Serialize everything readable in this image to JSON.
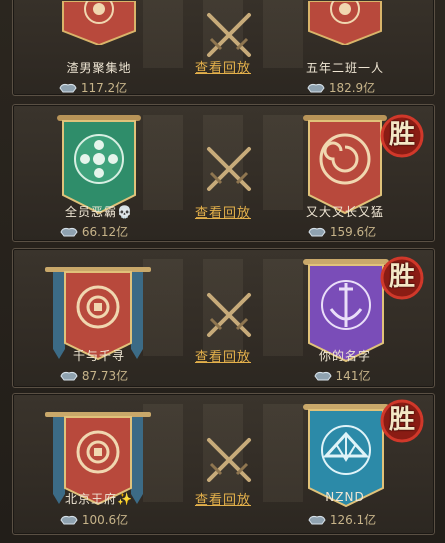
{
  "replay_label": "查看回放",
  "win_label": "胜",
  "matches": [
    {
      "left": {
        "name": "渣男聚集地",
        "power": "117.2亿",
        "banner": "sun"
      },
      "right": {
        "name": "五年二班一人",
        "power": "182.9亿",
        "banner": "sun"
      },
      "winner": "right"
    },
    {
      "left": {
        "name": "全员恶霸",
        "emoji": "💀",
        "power": "66.12亿",
        "banner": "flower"
      },
      "right": {
        "name": "又大又长又猛",
        "power": "159.6亿",
        "banner": "swirl"
      },
      "winner": "right"
    },
    {
      "left": {
        "name": "千与千寻",
        "power": "87.73亿",
        "banner": "coin"
      },
      "right": {
        "name": "你的名字",
        "power": "141亿",
        "banner": "sword"
      },
      "winner": "right"
    },
    {
      "left": {
        "name": "北京王府",
        "emoji": "✨",
        "power": "100.6亿",
        "banner": "coin"
      },
      "right": {
        "name": "NZND",
        "power": "126.1亿",
        "banner": "fan"
      },
      "winner": "right"
    }
  ],
  "colors": {
    "red_banner": "#b8493c",
    "green_banner": "#2f8d6a",
    "purple_banner": "#7a4db8",
    "teal_banner": "#2c8aa8",
    "replay_link": "#e3b04b",
    "power_text": "#c7b48a"
  }
}
